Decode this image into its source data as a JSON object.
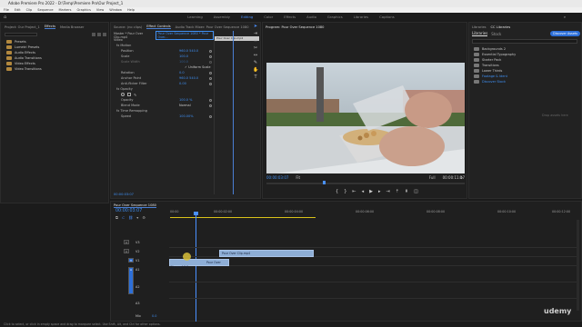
{
  "app": {
    "title": "Adobe Premiere Pro 2022 - D:\\Temp\\Premiere Pro\\Our Project_1"
  },
  "menu": [
    "File",
    "Edit",
    "Clip",
    "Sequence",
    "Markers",
    "Graphics",
    "View",
    "Window",
    "Help"
  ],
  "workspaces": [
    "Learning",
    "Assembly",
    "Editing",
    "Color",
    "Effects",
    "Audio",
    "Graphics",
    "Libraries",
    "Captions"
  ],
  "workspace_active": "Editing",
  "project_panel": {
    "tabs": [
      "Project: Our Project_1",
      "Effects",
      "Media Browser"
    ],
    "items": [
      "Presets",
      "Lumetri Presets",
      "Audio Effects",
      "Audio Transitions",
      "Video Effects",
      "Video Transitions"
    ]
  },
  "source_tabs": [
    "Source: (no clips)",
    "Effect Controls",
    "Audio Track Mixer: Pour Over Sequence 1080",
    "Audio Clip Mixer: Pour Over Sequence 1080"
  ],
  "effect_controls": {
    "master": "Master * Pour Over Clip.mp4",
    "clip": "Pour Over Sequence 1080 * Pour Over...",
    "video_label": "Video",
    "sections": [
      "fx Motion",
      "fx Opacity",
      "fx Time Remapping"
    ],
    "rows": [
      {
        "label": "Position",
        "value": "960.0   540.0"
      },
      {
        "label": "Scale",
        "value": "100.0"
      },
      {
        "label": "Scale Width",
        "value": "100.0"
      },
      {
        "label": "Uniform Scale",
        "value": "✓"
      },
      {
        "label": "Rotation",
        "value": "0.0"
      },
      {
        "label": "Anchor Point",
        "value": "960.0   540.0"
      },
      {
        "label": "Anti-flicker Filter",
        "value": "0.00"
      },
      {
        "label": "Opacity",
        "value": "100.0 %"
      },
      {
        "label": "Blend Mode",
        "value": "Normal"
      },
      {
        "label": "Speed",
        "value": "100.00%"
      }
    ],
    "timecode": "00:00:03:07",
    "clip_name": "Pour Over Clip.mp4"
  },
  "program": {
    "tabs": [
      "Program: Pour Over Sequence 1080"
    ],
    "timecode": "00:00:03:07",
    "fit": "Fit",
    "quality": "Full",
    "duration": "00:00:11:17"
  },
  "libraries": {
    "tabs": [
      "Libraries",
      "CC Libraries",
      "Essential Graphics"
    ],
    "button": "Discover Assets",
    "search_placeholder": "",
    "items": [
      "Backgrounds 2",
      "Essential Typography",
      "Starter Pack",
      "Transitions",
      "Lower Thirds",
      "Footage & Ident",
      "Discover Stock"
    ],
    "drop_hint": "Drop assets here"
  },
  "timeline": {
    "tab": "Pour Over Sequence 1080",
    "timecode": "00:00:03:07",
    "ruler": [
      "00:00",
      "00:00:02:00",
      "00:00:04:00",
      "00:00:06:00",
      "00:00:08:00",
      "00:00:10:00",
      "00:00:12:00",
      "00:00:14:00"
    ],
    "tracks": [
      "V3",
      "V2",
      "V1",
      "A1",
      "A2",
      "A3",
      "Mix"
    ],
    "clips": [
      {
        "name": "Pour Over Clip.mp4"
      },
      {
        "name": "Pour Over Clip.mp4 [V]"
      }
    ],
    "mix_value": "0.0"
  },
  "status": "Click to select, or click in empty space and drag to marquee select. Use Shift, Alt, and Ctrl for other options.",
  "watermark": "udemy"
}
